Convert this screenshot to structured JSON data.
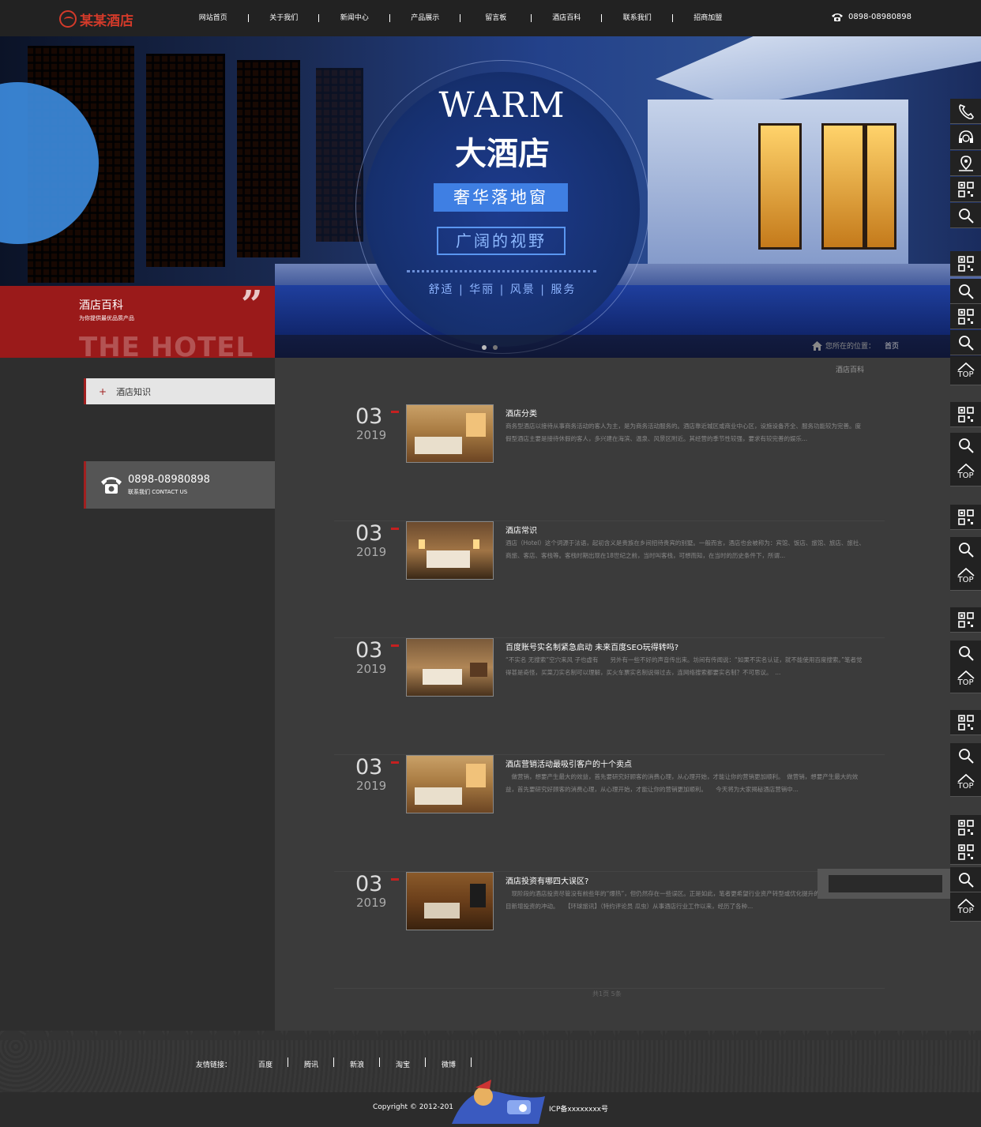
{
  "header": {
    "logo_text": "某某酒店",
    "nav": [
      "网站首页",
      "关于我们",
      "新闻中心",
      "产品展示",
      "留言板",
      "酒店百科",
      "联系我们",
      "招商加盟"
    ],
    "phone": "0898-08980898"
  },
  "banner": {
    "headline_en": "WARM",
    "headline_cn": "大酒店",
    "box1": "奢华落地窗",
    "box2": "广阔的视野",
    "tagline": "舒适 | 华丽 | 风景 | 服务",
    "breadcrumb_prefix": "您所在的位置：",
    "breadcrumb_home": "首页"
  },
  "section": {
    "title": "酒店百科",
    "subtitle": "为你提供最优品质产品",
    "bg_text": "THE HOTEL"
  },
  "sidebar": {
    "items": [
      {
        "label": "酒店知识"
      }
    ],
    "contact_phone": "0898-08980898",
    "contact_sub": "联系我们 CONTACT US"
  },
  "main": {
    "crumb": "酒店百科",
    "articles": [
      {
        "day": "03",
        "year": "2019",
        "title": "酒店分类",
        "desc": "商务型酒店以接待从事商务活动的客人为主，是为商务活动服务的。酒店靠近城区或商业中心区，设施设备齐全、服务功能较为完善。度假型酒店主要是接待休假的客人，多兴建在海滨、温泉、风景区附近。其经营的季节性较强，要求有较完善的娱乐..."
      },
      {
        "day": "03",
        "year": "2019",
        "title": "酒店常识",
        "desc": "酒店（Hotel）这个词源于法语，起初含义是贵族在乡间招待贵宾的别墅。一般而言，酒店也会被称为：宾馆、饭店、旅馆、旅店、旅社、商旅、客店、客栈等。客栈时期出现在18世纪之前，当时叫客栈，可想而知，在当时的历史条件下，所谓..."
      },
      {
        "day": "03",
        "year": "2019",
        "title": "百度账号实名制紧急启动 未来百度SEO玩得转吗?",
        "desc": "“不实名 无搜索”空穴来风 子也虚有　　另外有一些不好的声音传出来。坊间有传闻说：“如果不实名认证，就不能使用百度搜索。”笔者觉得甚是奇怪，买菜刀实名制可以理解，买火车票实名制说得过去，连网络搜索都要实名制？不可思议。　..."
      },
      {
        "day": "03",
        "year": "2019",
        "title": "酒店营销活动最吸引客户的十个卖点",
        "desc": "　做营销，想要产生最大的效益，首先要研究好顾客的消费心理，从心理开始，才能让你的营销更加顺利。　做营销，想要产生最大的效益，首先要研究好顾客的消费心理，从心理开始，才能让你的营销更加顺利。　　今天将为大家揭秘酒店营销中..."
      },
      {
        "day": "03",
        "year": "2019",
        "title": "酒店投资有哪四大误区?",
        "desc": "　现阶段的酒店投资尽管没有前些年的“爆热”，但仍然存在一些误区。正是如此，笔者更希望行业资产转型或优化提升的激情，少几分盲目新增投资的冲动。　　【环球旅讯】（特约评论员 瓜虫）从事酒店行业工作以来，经历了各种..."
      }
    ],
    "pager": "共1页 5条"
  },
  "floatbar": {
    "top_label": "TOP",
    "icons": [
      "phone-icon",
      "headset-icon",
      "location-icon",
      "qrcode-icon",
      "search-icon",
      "qrcode-icon",
      "search-icon",
      "qrcode-icon",
      "search-icon",
      "top-icon",
      "qrcode-icon",
      "search-icon",
      "top-icon",
      "qrcode-icon",
      "search-icon",
      "top-icon",
      "qrcode-icon",
      "search-icon",
      "top-icon",
      "qrcode-icon",
      "search-icon",
      "top-icon",
      "qrcode-icon",
      "qrcode-icon",
      "search-icon",
      "top-icon"
    ]
  },
  "footer": {
    "links_title": "友情链接：",
    "links": [
      "百度",
      "腾讯",
      "新浪",
      "淘宝",
      "微博"
    ],
    "copyright": "Copyright © 2012-201",
    "icp": "ICP备xxxxxxxx号"
  },
  "colors": {
    "accent": "#a12020",
    "banner_blue": "#1d3b8d",
    "header_bg": "#222222"
  }
}
